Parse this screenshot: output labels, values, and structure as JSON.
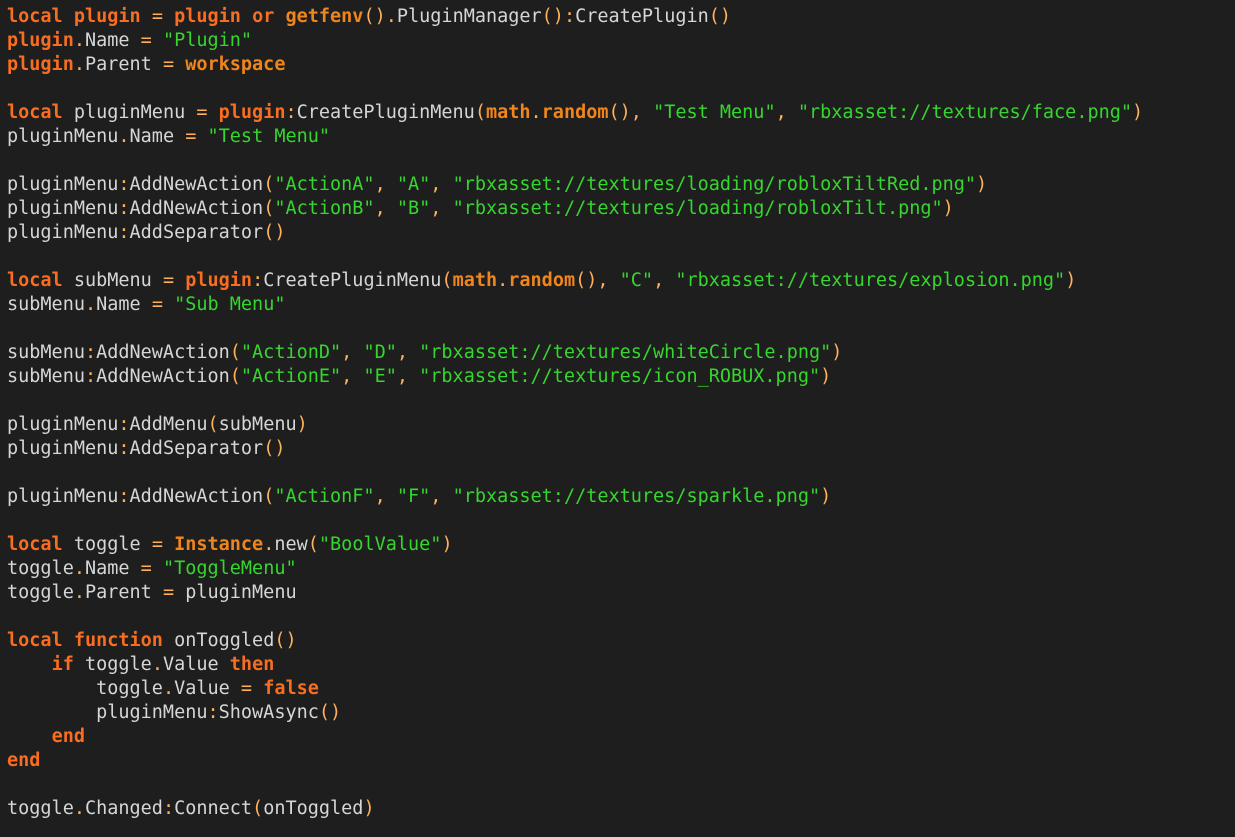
{
  "editor": {
    "language": "lua",
    "colors": {
      "background": "#1e1e1e",
      "text": "#d6d6d6",
      "keyword": "#f86d1f",
      "builtin": "#f0851c",
      "operator": "#ffb05a",
      "string": "#35d62d"
    },
    "lines": [
      [
        [
          "local",
          "keyword"
        ],
        [
          " ",
          "text"
        ],
        [
          "plugin",
          "keyword"
        ],
        [
          " ",
          "text"
        ],
        [
          "=",
          "op"
        ],
        [
          " ",
          "text"
        ],
        [
          "plugin",
          "keyword"
        ],
        [
          " ",
          "text"
        ],
        [
          "or",
          "keyword"
        ],
        [
          " ",
          "text"
        ],
        [
          "getfenv",
          "builtin"
        ],
        [
          "()",
          "op"
        ],
        [
          ".",
          "op"
        ],
        [
          "PluginManager",
          "text"
        ],
        [
          "()",
          "op"
        ],
        [
          ":",
          "op"
        ],
        [
          "CreatePlugin",
          "text"
        ],
        [
          "()",
          "op"
        ]
      ],
      [
        [
          "plugin",
          "keyword"
        ],
        [
          ".",
          "op"
        ],
        [
          "Name",
          "text"
        ],
        [
          " ",
          "text"
        ],
        [
          "=",
          "op"
        ],
        [
          " ",
          "text"
        ],
        [
          "\"Plugin\"",
          "string"
        ]
      ],
      [
        [
          "plugin",
          "keyword"
        ],
        [
          ".",
          "op"
        ],
        [
          "Parent",
          "text"
        ],
        [
          " ",
          "text"
        ],
        [
          "=",
          "op"
        ],
        [
          " ",
          "text"
        ],
        [
          "workspace",
          "builtin"
        ]
      ],
      [],
      [
        [
          "local",
          "keyword"
        ],
        [
          " pluginMenu ",
          "text"
        ],
        [
          "=",
          "op"
        ],
        [
          " ",
          "text"
        ],
        [
          "plugin",
          "keyword"
        ],
        [
          ":",
          "op"
        ],
        [
          "CreatePluginMenu",
          "text"
        ],
        [
          "(",
          "op"
        ],
        [
          "math",
          "builtin"
        ],
        [
          ".",
          "op"
        ],
        [
          "random",
          "builtin"
        ],
        [
          "()",
          "op"
        ],
        [
          ",",
          "op"
        ],
        [
          " ",
          "text"
        ],
        [
          "\"Test Menu\"",
          "string"
        ],
        [
          ",",
          "op"
        ],
        [
          " ",
          "text"
        ],
        [
          "\"rbxasset://textures/face.png\"",
          "string"
        ],
        [
          ")",
          "op"
        ]
      ],
      [
        [
          "pluginMenu",
          "text"
        ],
        [
          ".",
          "op"
        ],
        [
          "Name",
          "text"
        ],
        [
          " ",
          "text"
        ],
        [
          "=",
          "op"
        ],
        [
          " ",
          "text"
        ],
        [
          "\"Test Menu\"",
          "string"
        ]
      ],
      [],
      [
        [
          "pluginMenu",
          "text"
        ],
        [
          ":",
          "op"
        ],
        [
          "AddNewAction",
          "text"
        ],
        [
          "(",
          "op"
        ],
        [
          "\"ActionA\"",
          "string"
        ],
        [
          ",",
          "op"
        ],
        [
          " ",
          "text"
        ],
        [
          "\"A\"",
          "string"
        ],
        [
          ",",
          "op"
        ],
        [
          " ",
          "text"
        ],
        [
          "\"rbxasset://textures/loading/robloxTiltRed.png\"",
          "string"
        ],
        [
          ")",
          "op"
        ]
      ],
      [
        [
          "pluginMenu",
          "text"
        ],
        [
          ":",
          "op"
        ],
        [
          "AddNewAction",
          "text"
        ],
        [
          "(",
          "op"
        ],
        [
          "\"ActionB\"",
          "string"
        ],
        [
          ",",
          "op"
        ],
        [
          " ",
          "text"
        ],
        [
          "\"B\"",
          "string"
        ],
        [
          ",",
          "op"
        ],
        [
          " ",
          "text"
        ],
        [
          "\"rbxasset://textures/loading/robloxTilt.png\"",
          "string"
        ],
        [
          ")",
          "op"
        ]
      ],
      [
        [
          "pluginMenu",
          "text"
        ],
        [
          ":",
          "op"
        ],
        [
          "AddSeparator",
          "text"
        ],
        [
          "()",
          "op"
        ]
      ],
      [],
      [
        [
          "local",
          "keyword"
        ],
        [
          " subMenu ",
          "text"
        ],
        [
          "=",
          "op"
        ],
        [
          " ",
          "text"
        ],
        [
          "plugin",
          "keyword"
        ],
        [
          ":",
          "op"
        ],
        [
          "CreatePluginMenu",
          "text"
        ],
        [
          "(",
          "op"
        ],
        [
          "math",
          "builtin"
        ],
        [
          ".",
          "op"
        ],
        [
          "random",
          "builtin"
        ],
        [
          "()",
          "op"
        ],
        [
          ",",
          "op"
        ],
        [
          " ",
          "text"
        ],
        [
          "\"C\"",
          "string"
        ],
        [
          ",",
          "op"
        ],
        [
          " ",
          "text"
        ],
        [
          "\"rbxasset://textures/explosion.png\"",
          "string"
        ],
        [
          ")",
          "op"
        ]
      ],
      [
        [
          "subMenu",
          "text"
        ],
        [
          ".",
          "op"
        ],
        [
          "Name",
          "text"
        ],
        [
          " ",
          "text"
        ],
        [
          "=",
          "op"
        ],
        [
          " ",
          "text"
        ],
        [
          "\"Sub Menu\"",
          "string"
        ]
      ],
      [],
      [
        [
          "subMenu",
          "text"
        ],
        [
          ":",
          "op"
        ],
        [
          "AddNewAction",
          "text"
        ],
        [
          "(",
          "op"
        ],
        [
          "\"ActionD\"",
          "string"
        ],
        [
          ",",
          "op"
        ],
        [
          " ",
          "text"
        ],
        [
          "\"D\"",
          "string"
        ],
        [
          ",",
          "op"
        ],
        [
          " ",
          "text"
        ],
        [
          "\"rbxasset://textures/whiteCircle.png\"",
          "string"
        ],
        [
          ")",
          "op"
        ]
      ],
      [
        [
          "subMenu",
          "text"
        ],
        [
          ":",
          "op"
        ],
        [
          "AddNewAction",
          "text"
        ],
        [
          "(",
          "op"
        ],
        [
          "\"ActionE\"",
          "string"
        ],
        [
          ",",
          "op"
        ],
        [
          " ",
          "text"
        ],
        [
          "\"E\"",
          "string"
        ],
        [
          ",",
          "op"
        ],
        [
          " ",
          "text"
        ],
        [
          "\"rbxasset://textures/icon_ROBUX.png\"",
          "string"
        ],
        [
          ")",
          "op"
        ]
      ],
      [],
      [
        [
          "pluginMenu",
          "text"
        ],
        [
          ":",
          "op"
        ],
        [
          "AddMenu",
          "text"
        ],
        [
          "(",
          "op"
        ],
        [
          "subMenu",
          "text"
        ],
        [
          ")",
          "op"
        ]
      ],
      [
        [
          "pluginMenu",
          "text"
        ],
        [
          ":",
          "op"
        ],
        [
          "AddSeparator",
          "text"
        ],
        [
          "()",
          "op"
        ]
      ],
      [],
      [
        [
          "pluginMenu",
          "text"
        ],
        [
          ":",
          "op"
        ],
        [
          "AddNewAction",
          "text"
        ],
        [
          "(",
          "op"
        ],
        [
          "\"ActionF\"",
          "string"
        ],
        [
          ",",
          "op"
        ],
        [
          " ",
          "text"
        ],
        [
          "\"F\"",
          "string"
        ],
        [
          ",",
          "op"
        ],
        [
          " ",
          "text"
        ],
        [
          "\"rbxasset://textures/sparkle.png\"",
          "string"
        ],
        [
          ")",
          "op"
        ]
      ],
      [],
      [
        [
          "local",
          "keyword"
        ],
        [
          " toggle ",
          "text"
        ],
        [
          "=",
          "op"
        ],
        [
          " ",
          "text"
        ],
        [
          "Instance",
          "builtin"
        ],
        [
          ".",
          "op"
        ],
        [
          "new",
          "text"
        ],
        [
          "(",
          "op"
        ],
        [
          "\"BoolValue\"",
          "string"
        ],
        [
          ")",
          "op"
        ]
      ],
      [
        [
          "toggle",
          "text"
        ],
        [
          ".",
          "op"
        ],
        [
          "Name",
          "text"
        ],
        [
          " ",
          "text"
        ],
        [
          "=",
          "op"
        ],
        [
          " ",
          "text"
        ],
        [
          "\"ToggleMenu\"",
          "string"
        ]
      ],
      [
        [
          "toggle",
          "text"
        ],
        [
          ".",
          "op"
        ],
        [
          "Parent",
          "text"
        ],
        [
          " ",
          "text"
        ],
        [
          "=",
          "op"
        ],
        [
          " pluginMenu",
          "text"
        ]
      ],
      [],
      [
        [
          "local",
          "keyword"
        ],
        [
          " ",
          "text"
        ],
        [
          "function",
          "keyword"
        ],
        [
          " onToggled",
          "text"
        ],
        [
          "()",
          "op"
        ]
      ],
      [
        [
          "    ",
          "text"
        ],
        [
          "if",
          "keyword"
        ],
        [
          " toggle",
          "text"
        ],
        [
          ".",
          "op"
        ],
        [
          "Value",
          "text"
        ],
        [
          " ",
          "text"
        ],
        [
          "then",
          "keyword"
        ]
      ],
      [
        [
          "        toggle",
          "text"
        ],
        [
          ".",
          "op"
        ],
        [
          "Value",
          "text"
        ],
        [
          " ",
          "text"
        ],
        [
          "=",
          "op"
        ],
        [
          " ",
          "text"
        ],
        [
          "false",
          "keyword"
        ]
      ],
      [
        [
          "        pluginMenu",
          "text"
        ],
        [
          ":",
          "op"
        ],
        [
          "ShowAsync",
          "text"
        ],
        [
          "()",
          "op"
        ]
      ],
      [
        [
          "    ",
          "text"
        ],
        [
          "end",
          "keyword"
        ]
      ],
      [
        [
          "end",
          "keyword"
        ]
      ],
      [],
      [
        [
          "toggle",
          "text"
        ],
        [
          ".",
          "op"
        ],
        [
          "Changed",
          "text"
        ],
        [
          ":",
          "op"
        ],
        [
          "Connect",
          "text"
        ],
        [
          "(",
          "op"
        ],
        [
          "onToggled",
          "text"
        ],
        [
          ")",
          "op"
        ]
      ]
    ]
  }
}
